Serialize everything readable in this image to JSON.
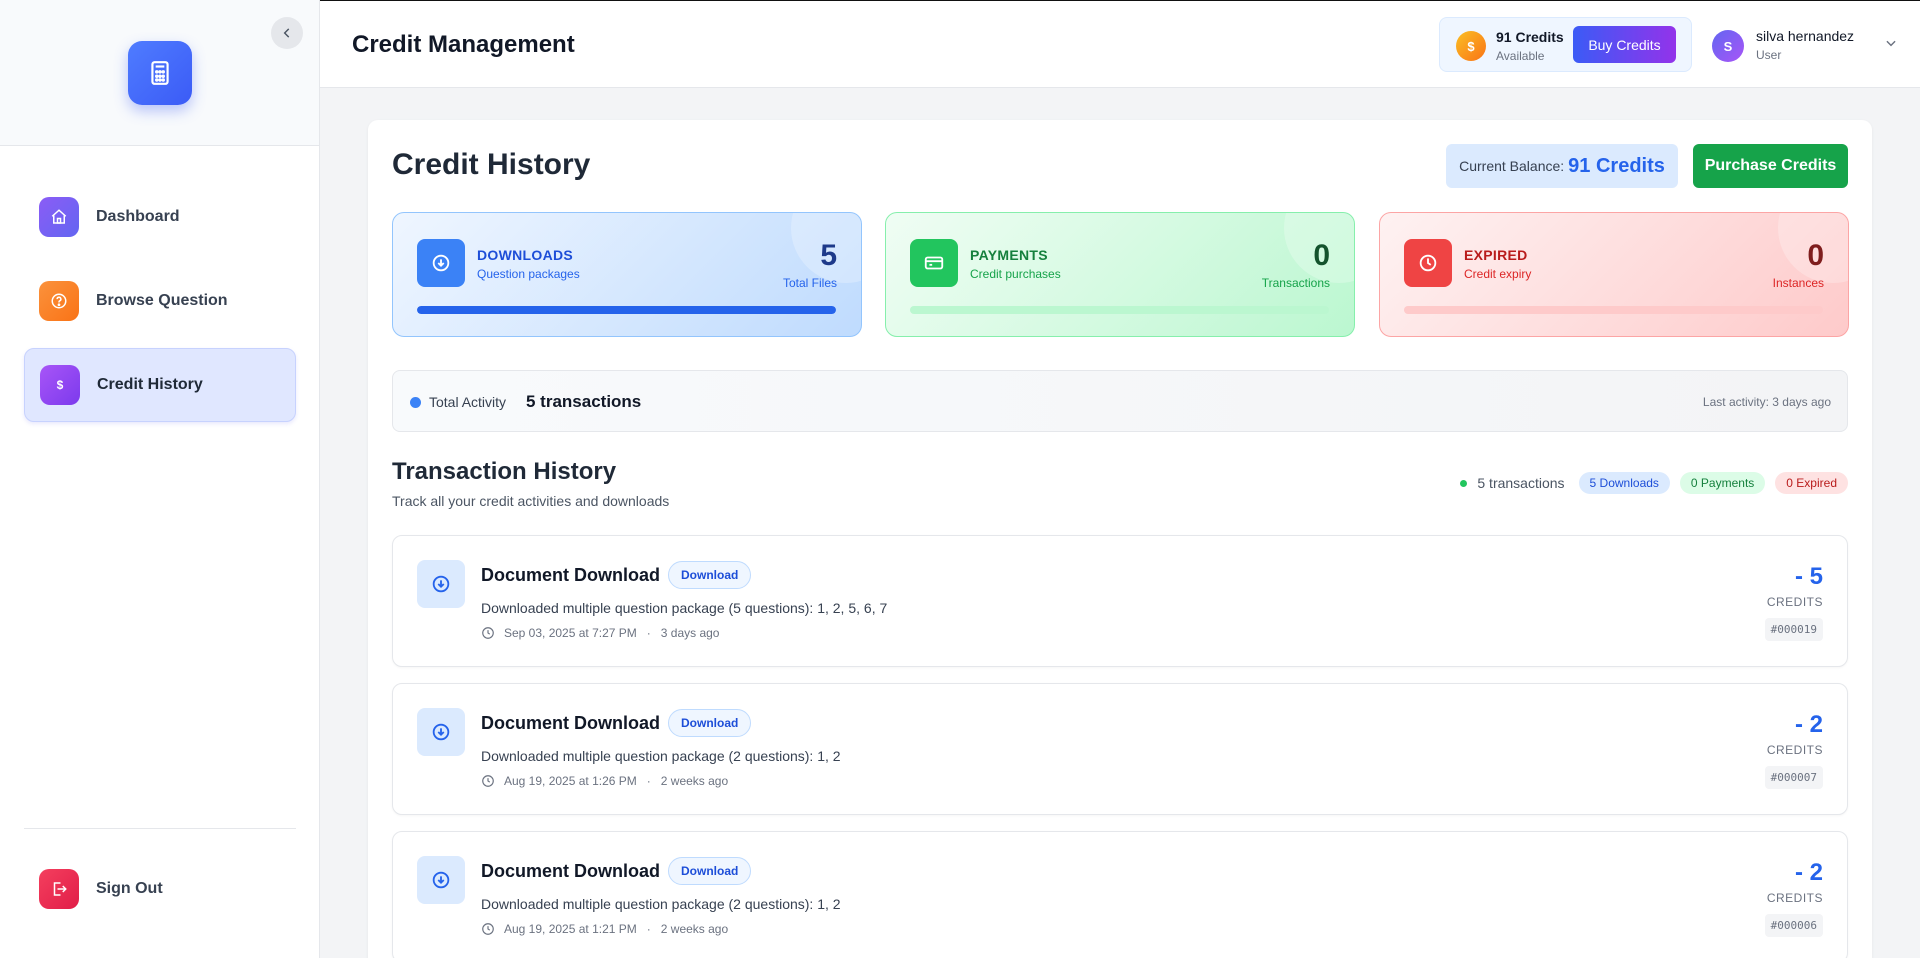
{
  "header": {
    "title": "Credit Management",
    "credits_amount": "91 Credits",
    "credits_sub": "Available",
    "buy_label": "Buy Credits",
    "user_initial": "S",
    "user_name": "silva hernandez",
    "user_role": "User"
  },
  "sidebar": {
    "items": [
      {
        "label": "Dashboard",
        "icon": "home-icon",
        "color": "#7c3aed"
      },
      {
        "label": "Browse Question",
        "icon": "question-circle-icon",
        "color": "#f97316"
      },
      {
        "label": "Credit History",
        "icon": "dollar-icon",
        "color": "#8b5cf6"
      }
    ],
    "signout_label": "Sign Out"
  },
  "main": {
    "title": "Credit History",
    "balance_label": "Current Balance:",
    "balance_value": "91 Credits",
    "purchase_label": "Purchase Credits",
    "stats": [
      {
        "label": "DOWNLOADS",
        "sub": "Question packages",
        "value": "5",
        "unit": "Total Files",
        "fill": 1.0
      },
      {
        "label": "PAYMENTS",
        "sub": "Credit purchases",
        "value": "0",
        "unit": "Transactions",
        "fill": 0.0
      },
      {
        "label": "EXPIRED",
        "sub": "Credit expiry",
        "value": "0",
        "unit": "Instances",
        "fill": 0.0
      }
    ],
    "activity": {
      "label": "Total Activity",
      "count": "5 transactions",
      "last": "Last activity: 3 days ago"
    },
    "history": {
      "title": "Transaction History",
      "subtitle": "Track all your credit activities and downloads",
      "count": "5 transactions",
      "tags": [
        "5 Downloads",
        "0 Payments",
        "0 Expired"
      ]
    },
    "transactions": [
      {
        "title": "Document Download",
        "badge": "Download",
        "desc": "Downloaded multiple question package (5 questions): 1, 2, 5, 6, 7",
        "date": "Sep 03, 2025 at 7:27 PM",
        "ago": "3 days ago",
        "amount": "- 5",
        "unit": "CREDITS",
        "id": "#000019"
      },
      {
        "title": "Document Download",
        "badge": "Download",
        "desc": "Downloaded multiple question package (2 questions): 1, 2",
        "date": "Aug 19, 2025 at 1:26 PM",
        "ago": "2 weeks ago",
        "amount": "- 2",
        "unit": "CREDITS",
        "id": "#000007"
      },
      {
        "title": "Document Download",
        "badge": "Download",
        "desc": "Downloaded multiple question package (2 questions): 1, 2",
        "date": "Aug 19, 2025 at 1:21 PM",
        "ago": "2 weeks ago",
        "amount": "- 2",
        "unit": "CREDITS",
        "id": "#000006"
      }
    ]
  }
}
